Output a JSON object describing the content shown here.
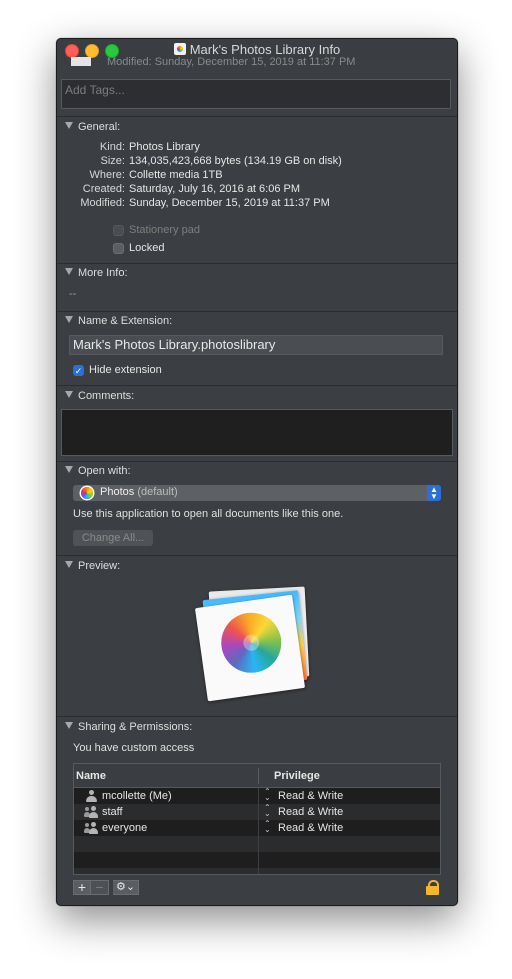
{
  "window": {
    "title": "Mark's Photos Library Info",
    "modified_peek": "Modified: Sunday, December 15, 2019 at 11:37 PM"
  },
  "tags": {
    "placeholder": "Add Tags..."
  },
  "general": {
    "heading": "General:",
    "rows": [
      {
        "label": "Kind:",
        "value": "Photos Library"
      },
      {
        "label": "Size:",
        "value": "134,035,423,668 bytes (134.19 GB on disk)"
      },
      {
        "label": "Where:",
        "value": "Collette media 1TB"
      },
      {
        "label": "Created:",
        "value": "Saturday, July 16, 2016 at 6:06 PM"
      },
      {
        "label": "Modified:",
        "value": "Sunday, December 15, 2019 at 11:37 PM"
      }
    ],
    "stationery_label": "Stationery pad",
    "locked_label": "Locked"
  },
  "more_info": {
    "heading": "More Info:",
    "value": "--"
  },
  "name_extension": {
    "heading": "Name & Extension:",
    "name": "Mark's Photos Library.photoslibrary",
    "hide_extension_label": "Hide extension",
    "hide_extension_checked": true
  },
  "comments": {
    "heading": "Comments:",
    "value": ""
  },
  "open_with": {
    "heading": "Open with:",
    "app": "Photos",
    "app_suffix": "(default)",
    "app_icon": "photos-app-icon",
    "description": "Use this application to open all documents like this one.",
    "change_all_label": "Change All..."
  },
  "preview": {
    "heading": "Preview:",
    "icon": "photos-library-icon"
  },
  "sharing": {
    "heading": "Sharing & Permissions:",
    "access_text": "You have custom access",
    "columns": [
      "Name",
      "Privilege"
    ],
    "rows": [
      {
        "name": "mcollette (Me)",
        "privilege": "Read & Write",
        "icon": "user-icon"
      },
      {
        "name": "staff",
        "privilege": "Read & Write",
        "icon": "group-icon"
      },
      {
        "name": "everyone",
        "privilege": "Read & Write",
        "icon": "group-icon"
      }
    ],
    "add_label": "+",
    "remove_label": "−",
    "gear_label": "⚙⌄",
    "lock_icon": "lock-icon"
  },
  "colors": {
    "window_bg": "#3b3e42",
    "accent": "#2d6fd6",
    "lock": "#f5b62a"
  }
}
